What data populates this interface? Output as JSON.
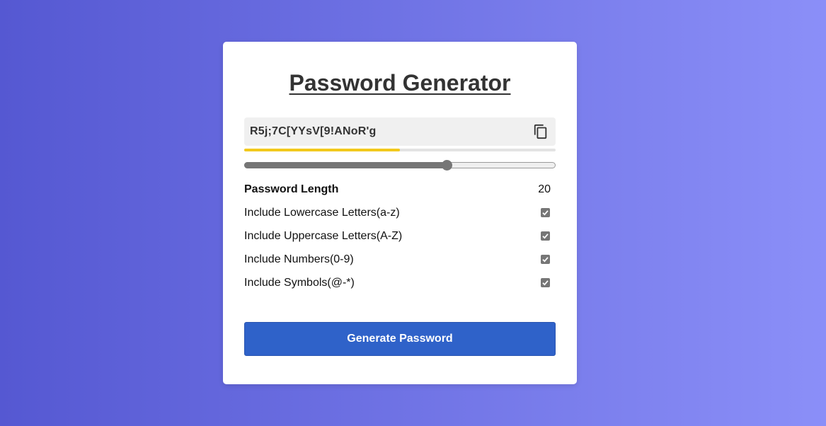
{
  "app": {
    "title": "Password Generator"
  },
  "password": {
    "value": "R5j;7C[YYsV[9!ANoR'g",
    "copy_icon": "copy-icon"
  },
  "strength": {
    "level": 0.5,
    "color": "#f2c91d"
  },
  "length": {
    "label": "Password Length",
    "value": "20",
    "slider_fraction": 0.65
  },
  "options": [
    {
      "label": "Include Lowercase Letters(a-z)",
      "checked": true
    },
    {
      "label": "Include Uppercase Letters(A-Z)",
      "checked": true
    },
    {
      "label": "Include Numbers(0-9)",
      "checked": true
    },
    {
      "label": "Include Symbols(@-*)",
      "checked": true
    }
  ],
  "generate": {
    "label": "Generate Password",
    "color": "#2f62c9"
  }
}
